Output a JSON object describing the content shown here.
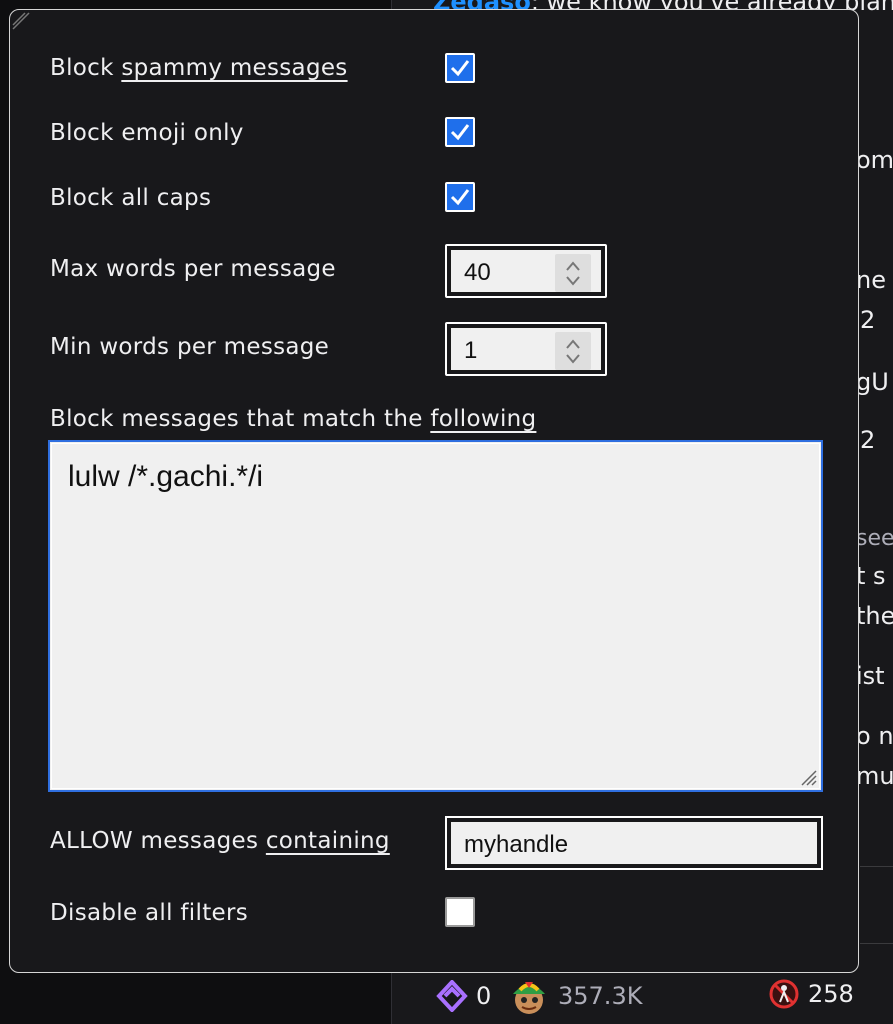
{
  "background_chat": {
    "top_user": "Zedaso",
    "top_text": ": we know you've already plan",
    "fragments": [
      "om",
      "ne t",
      "2",
      "gU",
      "2",
      "see",
      "t s",
      "the",
      "ist",
      "o n",
      "mu"
    ],
    "bottom_bar": {
      "points_value": "0",
      "viewer_value": "357.3K",
      "blocked_count": "258"
    }
  },
  "filters": {
    "spammy": {
      "label_prefix": "Block ",
      "label_link": "spammy messages",
      "checked": true
    },
    "emoji_only": {
      "label": "Block emoji only",
      "checked": true
    },
    "all_caps": {
      "label": "Block all caps",
      "checked": true
    },
    "max_words": {
      "label": "Max words per message",
      "value": "40"
    },
    "min_words": {
      "label": "Min words per message",
      "value": "1"
    },
    "match": {
      "label_prefix": "Block messages that match the ",
      "label_link": "following",
      "value": "lulw /*.gachi.*/i"
    },
    "allow": {
      "label_prefix": "ALLOW messages ",
      "label_link": "containing",
      "value": "myhandle"
    },
    "disable_all": {
      "label": "Disable all filters",
      "checked": false
    }
  },
  "colors": {
    "accent": "#1f6feb",
    "modal_bg": "#18181b",
    "text": "#efeff1",
    "username": "#1e90ff",
    "points_icon": "#a970ff"
  }
}
